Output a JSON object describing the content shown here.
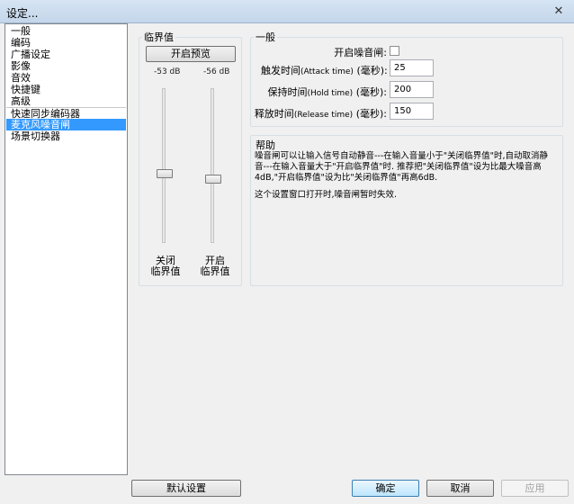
{
  "window": {
    "title": "设定...",
    "close_glyph": "✕"
  },
  "sidebar": {
    "items": [
      {
        "label": "一般"
      },
      {
        "label": "编码"
      },
      {
        "label": "广播设定"
      },
      {
        "label": "影像"
      },
      {
        "label": "音效"
      },
      {
        "label": "快捷键"
      },
      {
        "label": "高级"
      },
      {
        "label": "快速同步编码器"
      },
      {
        "label": "麦克风噪音闸"
      },
      {
        "label": "场景切换器"
      }
    ],
    "selected_index": 8
  },
  "threshold": {
    "group_title": "临界值",
    "preview_button": "开启预览",
    "close_db": "-53 dB",
    "open_db": "-56 dB",
    "close_label_1": "关闭",
    "close_label_2": "临界值",
    "open_label_1": "开启",
    "open_label_2": "临界值"
  },
  "general": {
    "group_title": "一般",
    "enable_label": "开启噪音闸:",
    "enable_checked": false,
    "attack_label": "触发时间",
    "attack_en": "(Attack time)",
    "attack_unit": "(毫秒):",
    "attack_value": "25",
    "hold_label": "保持时间",
    "hold_en": "(Hold time)",
    "hold_unit": "(毫秒):",
    "hold_value": "200",
    "release_label": "释放时间",
    "release_en": "(Release time)",
    "release_unit": "(毫秒):",
    "release_value": "150"
  },
  "help": {
    "title": "帮助",
    "line1": "噪音闸可以让输入信号自动静音---在输入音量小于\"关闭临界值\"时,自动取消静",
    "line2": "音---在输入音量大于\"开启临界值\"时. 推荐把\"关闭临界值\"设为比最大噪音高",
    "line3": "4dB,\"开启临界值\"设为比\"关闭临界值\"再高6dB.",
    "line4": "这个设置窗口打开时,噪音闸暂时失效."
  },
  "footer": {
    "defaults_button": "默认设置",
    "ok_button": "确定",
    "cancel_button": "取消",
    "apply_button": "应用"
  }
}
